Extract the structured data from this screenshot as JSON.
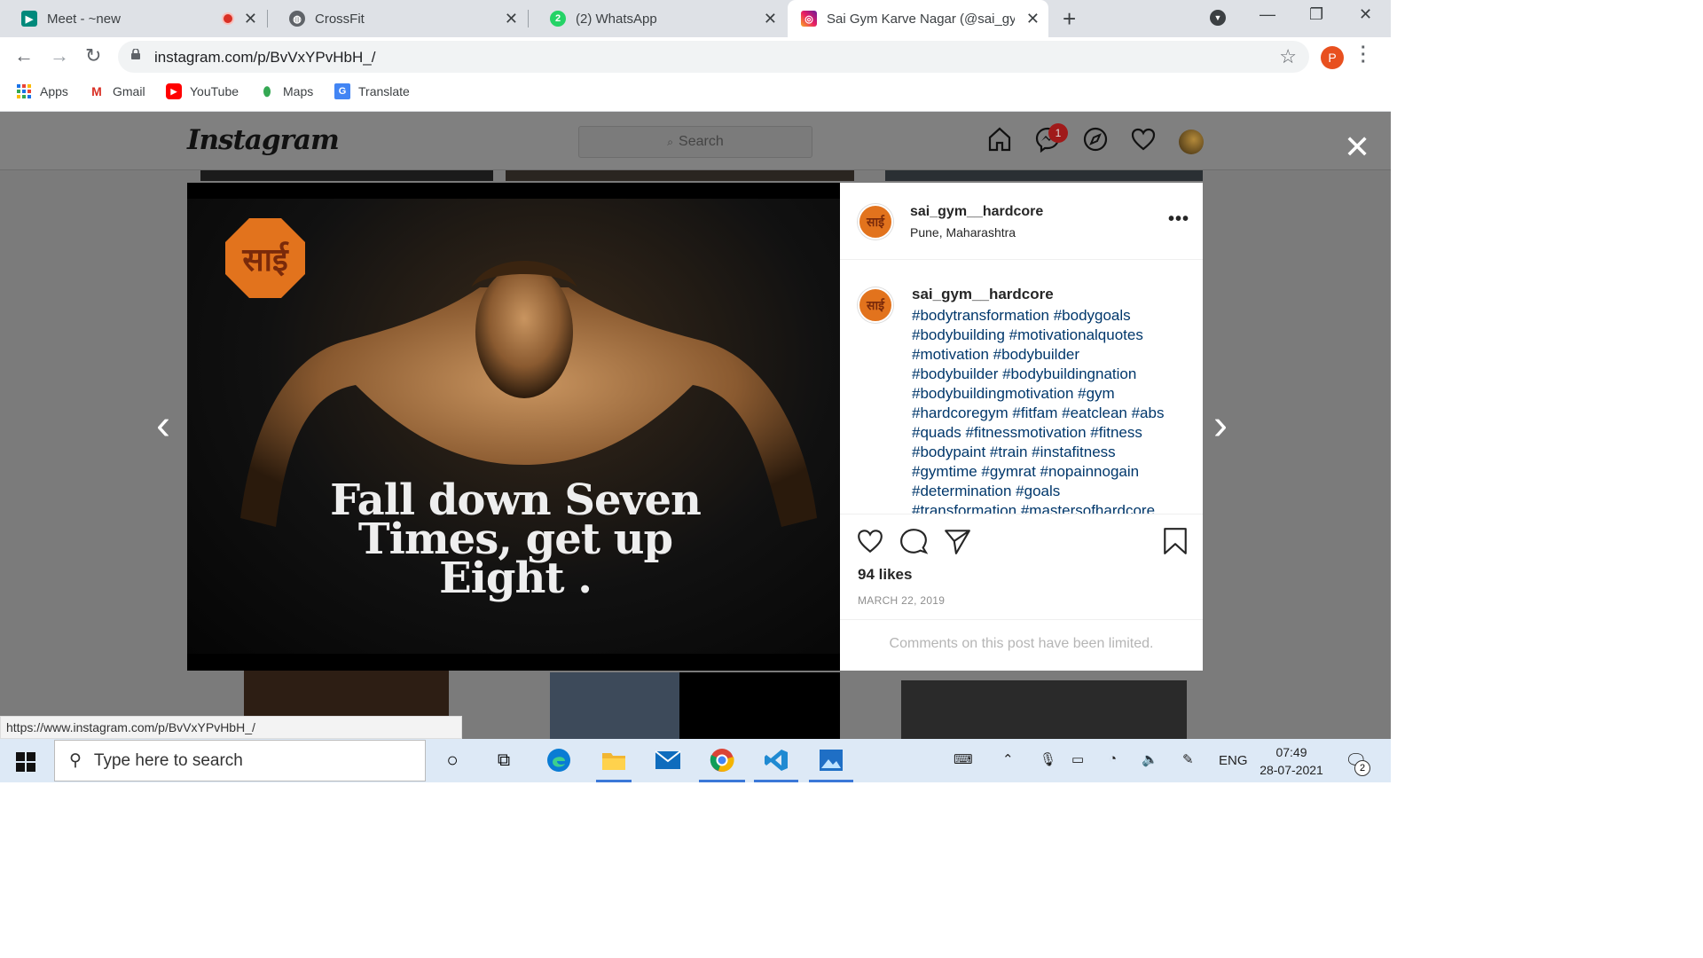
{
  "browser": {
    "tabs": [
      {
        "title": "Meet - ~new",
        "recording": true
      },
      {
        "title": "CrossFit"
      },
      {
        "title": "(2) WhatsApp",
        "badge": "2"
      },
      {
        "title": "Sai Gym Karve Nagar (@sai_gym_",
        "active": true
      }
    ],
    "url": "instagram.com/p/BvVxYPvHbH_/",
    "profile_initial": "P",
    "bookmarks": [
      "Apps",
      "Gmail",
      "YouTube",
      "Maps",
      "Translate"
    ],
    "status_url": "https://www.instagram.com/p/BvVxYPvHbH_/"
  },
  "instagram": {
    "logo": "Instagram",
    "search_placeholder": "Search",
    "notification_count": "1",
    "post": {
      "quote_lines": [
        "Fall down Seven",
        "Times, get up",
        "Eight ."
      ],
      "seal_text": "साई",
      "username": "sai_gym__hardcore",
      "location": "Pune, Maharashtra",
      "caption_lines": [
        "#bodytransformation #bodygoals",
        "#bodybuilding #motivationalquotes",
        "#motivation #bodybuilder",
        "#bodybuilder #bodybuildingnation",
        "#bodybuildingmotivation #gym",
        "#hardcoregym #fitfam #eatclean #abs",
        "#quads #fitnessmotivation #fitness",
        "#bodypaint #train #instafitness",
        "#gymtime #gymrat #nopainnogain",
        "#determination #goals",
        "#transformation #mastersofhardcore"
      ],
      "likes": "94 likes",
      "date": "MARCH 22, 2019",
      "comments_limited": "Comments on this post have been limited."
    }
  },
  "taskbar": {
    "search_placeholder": "Type here to search",
    "language": "ENG",
    "time": "07:49",
    "date": "28-07-2021",
    "notification_count": "2"
  },
  "colors": {
    "accent": "#3b78d8",
    "instagram_link": "#00376b",
    "seal_orange": "#e2731d"
  }
}
